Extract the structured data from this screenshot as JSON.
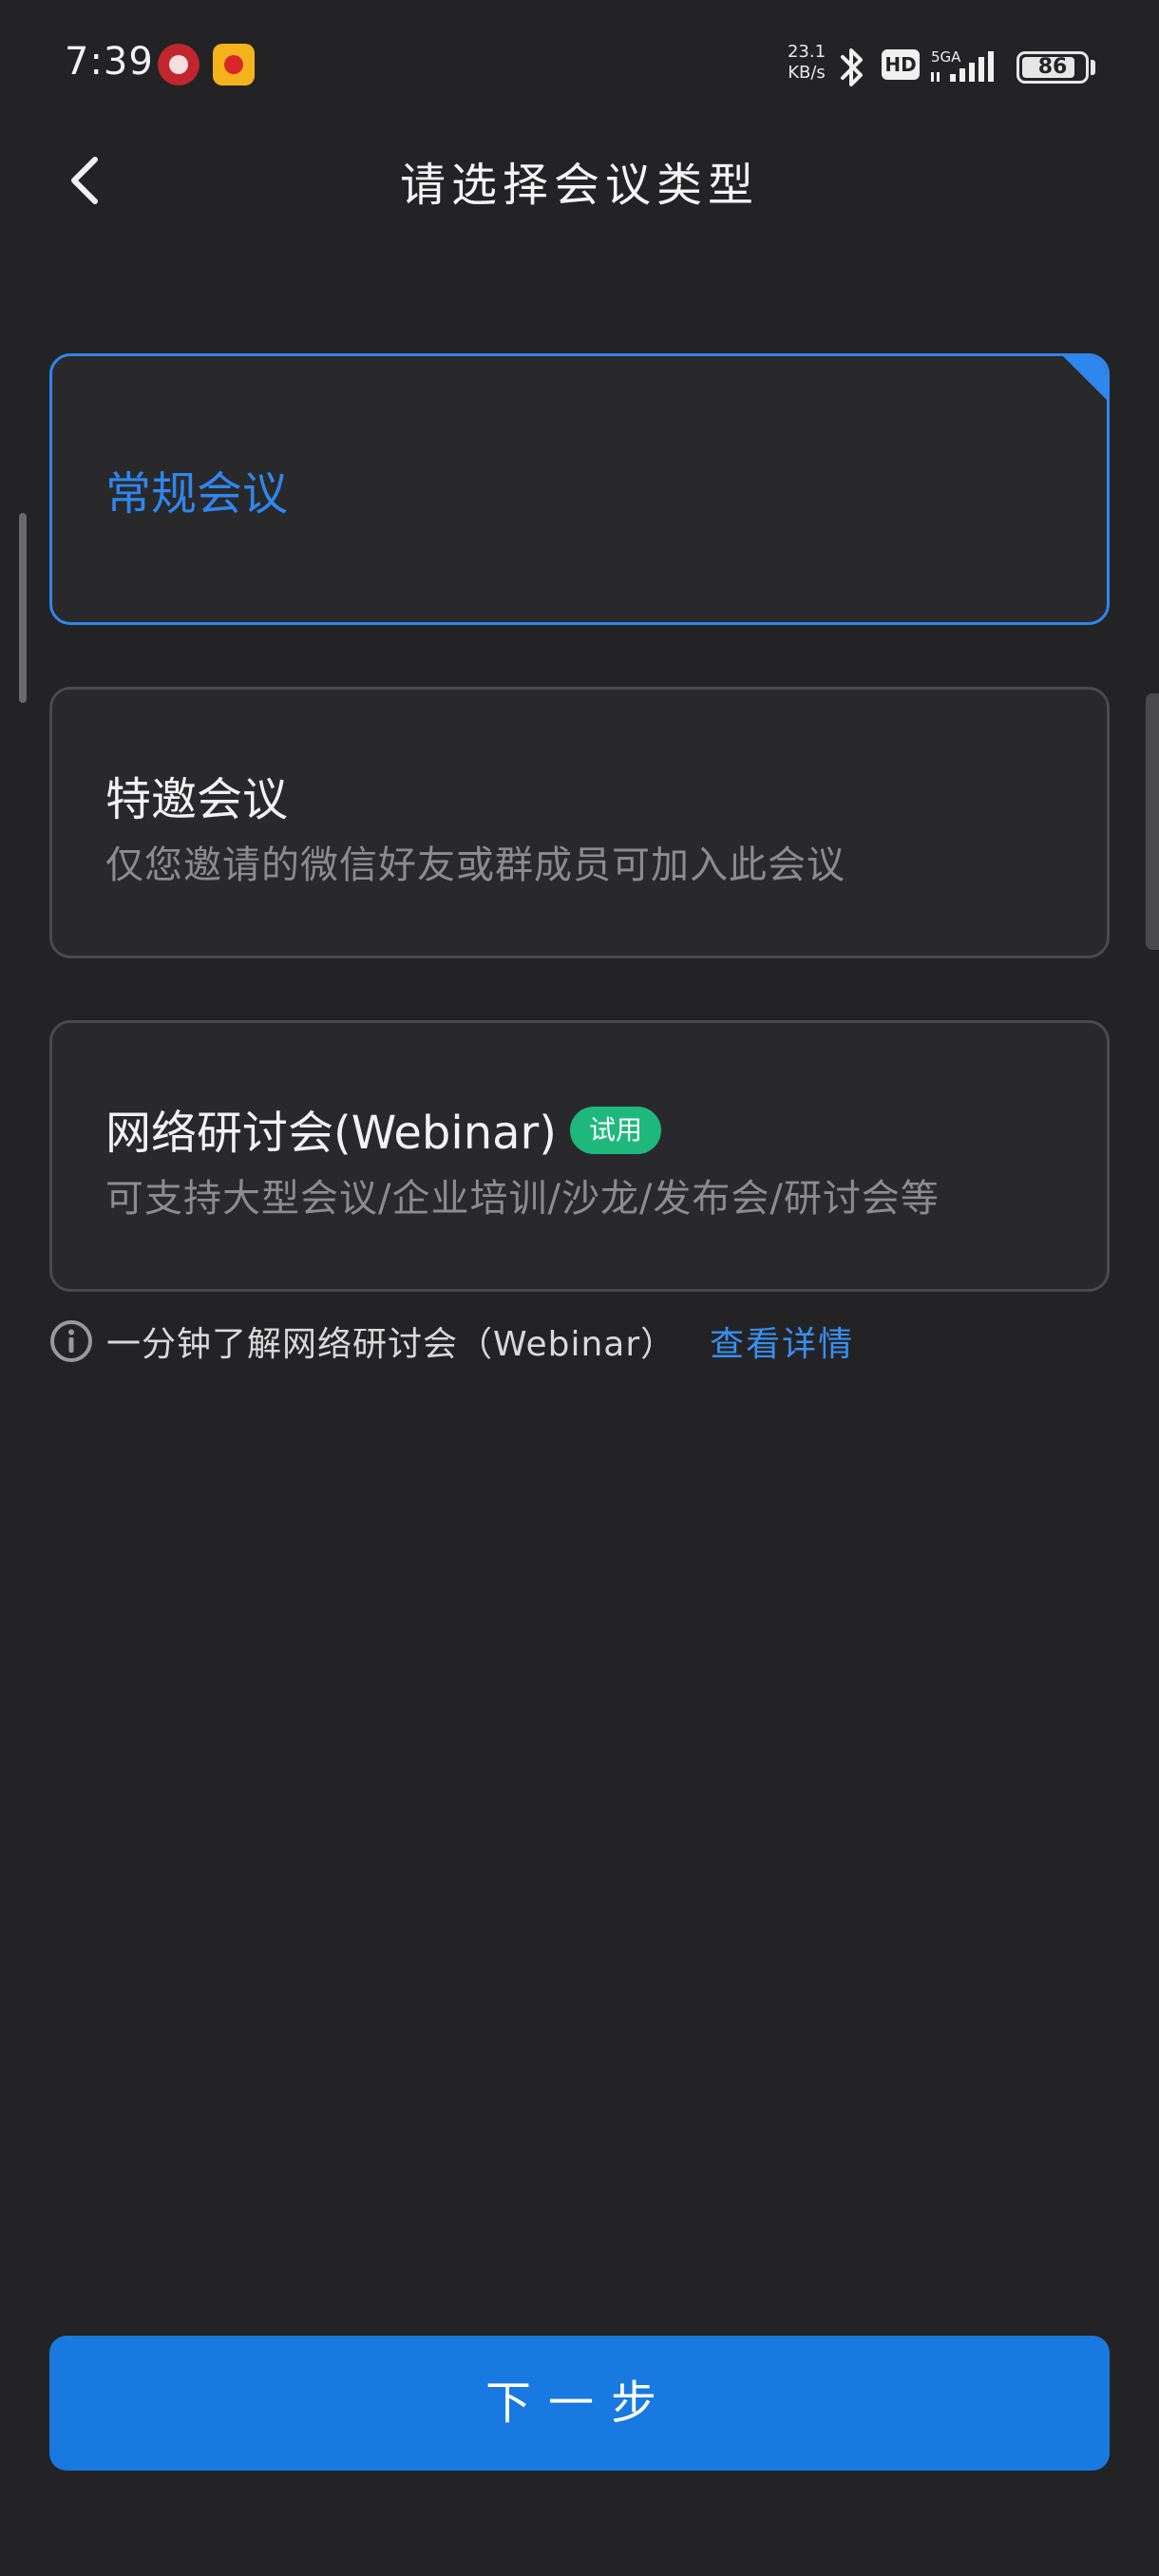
{
  "status_bar": {
    "time": "7:39",
    "net_speed_value": "23.1",
    "net_speed_unit": "KB/s",
    "hd_label": "HD",
    "network_type": "5GA",
    "battery_level": "86",
    "battery_fraction": 0.86
  },
  "header": {
    "title": "请选择会议类型"
  },
  "options": [
    {
      "title": "常规会议",
      "description": "",
      "selected": true
    },
    {
      "title": "特邀会议",
      "description": "仅您邀请的微信好友或群成员可加入此会议",
      "selected": false
    },
    {
      "title": "网络研讨会(Webinar)",
      "badge": "试用",
      "description": "可支持大型会议/企业培训/沙龙/发布会/研讨会等",
      "selected": false
    }
  ],
  "info": {
    "text": "一分钟了解网络研讨会（Webinar）",
    "link_label": "查看详情"
  },
  "footer": {
    "next_label": "下一步"
  },
  "colors": {
    "background": "#232325",
    "card_background": "#29292c",
    "accent": "#2f86ec",
    "primary_button": "#1879e0",
    "badge_green": "#1fb87c"
  }
}
